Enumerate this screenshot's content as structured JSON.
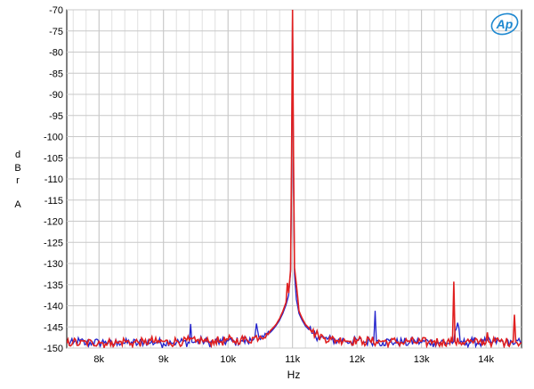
{
  "chart_data": {
    "type": "line",
    "title": "",
    "xlabel": "Hz",
    "ylabel": [
      "d",
      "B",
      "r",
      "A"
    ],
    "xscale": "linear",
    "xlim": [
      7500,
      14550
    ],
    "ylim": [
      -150,
      -70
    ],
    "grid": true,
    "x_ticks": [
      8000,
      9000,
      10000,
      11000,
      12000,
      13000,
      14000
    ],
    "x_tick_labels": [
      "8k",
      "9k",
      "10k",
      "11k",
      "12k",
      "13k",
      "14k"
    ],
    "y_ticks": [
      -70,
      -75,
      -80,
      -85,
      -90,
      -95,
      -100,
      -105,
      -110,
      -115,
      -120,
      -125,
      -130,
      -135,
      -140,
      -145,
      -150
    ],
    "y_tick_labels": [
      "-70",
      "-75",
      "-80",
      "-85",
      "-90",
      "-95",
      "-100",
      "-105",
      "-110",
      "-115",
      "-120",
      "-125",
      "-130",
      "-135",
      "-140",
      "-145",
      "-150"
    ],
    "logo": {
      "text": "AP",
      "color": "#1e88d0"
    },
    "series": [
      {
        "color": "#2222cc",
        "noise_floor": -148.8,
        "points": [
          [
            7500,
            -148.7
          ],
          [
            7600,
            -148.9
          ],
          [
            7700,
            -148.3
          ],
          [
            7800,
            -149.0
          ],
          [
            7900,
            -148.6
          ],
          [
            8000,
            -148.8
          ],
          [
            8100,
            -148.4
          ],
          [
            8200,
            -149.1
          ],
          [
            8300,
            -148.5
          ],
          [
            8400,
            -148.9
          ],
          [
            8500,
            -148.6
          ],
          [
            8600,
            -149.0
          ],
          [
            8700,
            -148.4
          ],
          [
            8800,
            -148.8
          ],
          [
            8900,
            -148.5
          ],
          [
            9000,
            -148.9
          ],
          [
            9100,
            -148.3
          ],
          [
            9200,
            -148.7
          ],
          [
            9300,
            -148.5
          ],
          [
            9400,
            -148.8
          ],
          [
            9420,
            -144.3
          ],
          [
            9440,
            -148.6
          ],
          [
            9500,
            -148.6
          ],
          [
            9600,
            -148.2
          ],
          [
            9700,
            -148.8
          ],
          [
            9800,
            -148.4
          ],
          [
            9900,
            -148.7
          ],
          [
            10000,
            -148.3
          ],
          [
            10100,
            -148.6
          ],
          [
            10200,
            -148.2
          ],
          [
            10300,
            -148.5
          ],
          [
            10400,
            -147.9
          ],
          [
            10440,
            -144.2
          ],
          [
            10480,
            -147.6
          ],
          [
            10550,
            -147.5
          ],
          [
            10600,
            -147.0
          ],
          [
            10650,
            -146.4
          ],
          [
            10700,
            -145.6
          ],
          [
            10750,
            -144.6
          ],
          [
            10800,
            -143.4
          ],
          [
            10850,
            -141.8
          ],
          [
            10900,
            -139.8
          ],
          [
            10940,
            -137.5
          ],
          [
            10970,
            -132.0
          ],
          [
            10985,
            -110.0
          ],
          [
            11000,
            -70.0
          ],
          [
            11015,
            -110.0
          ],
          [
            11030,
            -132.5
          ],
          [
            11060,
            -138.5
          ],
          [
            11100,
            -141.8
          ],
          [
            11150,
            -143.5
          ],
          [
            11200,
            -144.8
          ],
          [
            11250,
            -145.6
          ],
          [
            11300,
            -146.5
          ],
          [
            11400,
            -147.3
          ],
          [
            11500,
            -147.8
          ],
          [
            11600,
            -148.0
          ],
          [
            11700,
            -148.3
          ],
          [
            11800,
            -148.1
          ],
          [
            11900,
            -148.5
          ],
          [
            12000,
            -148.2
          ],
          [
            12100,
            -148.6
          ],
          [
            12200,
            -148.4
          ],
          [
            12260,
            -148.3
          ],
          [
            12280,
            -141.2
          ],
          [
            12300,
            -148.4
          ],
          [
            12400,
            -148.7
          ],
          [
            12500,
            -148.3
          ],
          [
            12600,
            -148.8
          ],
          [
            12700,
            -148.5
          ],
          [
            12800,
            -148.9
          ],
          [
            12900,
            -148.4
          ],
          [
            13000,
            -148.7
          ],
          [
            13100,
            -148.3
          ],
          [
            13200,
            -148.8
          ],
          [
            13300,
            -148.5
          ],
          [
            13400,
            -148.9
          ],
          [
            13500,
            -148.4
          ],
          [
            13560,
            -144.0
          ],
          [
            13600,
            -148.6
          ],
          [
            13700,
            -148.8
          ],
          [
            13800,
            -148.4
          ],
          [
            13900,
            -148.9
          ],
          [
            14000,
            -148.5
          ],
          [
            14100,
            -148.7
          ],
          [
            14200,
            -148.3
          ],
          [
            14300,
            -148.8
          ],
          [
            14400,
            -148.5
          ],
          [
            14450,
            -148.9
          ],
          [
            14550,
            -148.6
          ]
        ]
      },
      {
        "color": "#e02020",
        "noise_floor": -148.6,
        "points": [
          [
            7500,
            -148.9
          ],
          [
            7600,
            -148.5
          ],
          [
            7700,
            -149.1
          ],
          [
            7800,
            -148.6
          ],
          [
            7900,
            -148.9
          ],
          [
            8000,
            -148.4
          ],
          [
            8100,
            -149.0
          ],
          [
            8200,
            -148.6
          ],
          [
            8300,
            -148.8
          ],
          [
            8400,
            -148.3
          ],
          [
            8500,
            -148.9
          ],
          [
            8600,
            -148.5
          ],
          [
            8700,
            -148.8
          ],
          [
            8800,
            -148.2
          ],
          [
            8900,
            -148.7
          ],
          [
            9000,
            -148.4
          ],
          [
            9100,
            -148.8
          ],
          [
            9200,
            -148.3
          ],
          [
            9300,
            -148.6
          ],
          [
            9400,
            -148.2
          ],
          [
            9500,
            -148.5
          ],
          [
            9600,
            -148.1
          ],
          [
            9700,
            -148.6
          ],
          [
            9800,
            -148.2
          ],
          [
            9900,
            -148.5
          ],
          [
            10000,
            -148.0
          ],
          [
            10100,
            -148.4
          ],
          [
            10200,
            -147.9
          ],
          [
            10300,
            -148.2
          ],
          [
            10400,
            -147.6
          ],
          [
            10500,
            -147.2
          ],
          [
            10600,
            -146.6
          ],
          [
            10650,
            -146.0
          ],
          [
            10700,
            -145.2
          ],
          [
            10750,
            -144.3
          ],
          [
            10800,
            -143.0
          ],
          [
            10850,
            -141.3
          ],
          [
            10900,
            -139.2
          ],
          [
            10920,
            -134.6
          ],
          [
            10940,
            -137.0
          ],
          [
            10970,
            -131.5
          ],
          [
            10985,
            -105.0
          ],
          [
            11000,
            -70.0
          ],
          [
            11015,
            -105.0
          ],
          [
            11030,
            -131.0
          ],
          [
            11055,
            -134.4
          ],
          [
            11080,
            -138.0
          ],
          [
            11100,
            -141.2
          ],
          [
            11150,
            -143.0
          ],
          [
            11200,
            -144.4
          ],
          [
            11250,
            -145.2
          ],
          [
            11300,
            -146.2
          ],
          [
            11400,
            -147.0
          ],
          [
            11500,
            -147.6
          ],
          [
            11600,
            -147.9
          ],
          [
            11700,
            -148.2
          ],
          [
            11800,
            -147.9
          ],
          [
            11900,
            -148.4
          ],
          [
            12000,
            -148.1
          ],
          [
            12100,
            -148.5
          ],
          [
            12200,
            -148.2
          ],
          [
            12300,
            -148.6
          ],
          [
            12400,
            -148.3
          ],
          [
            12500,
            -148.7
          ],
          [
            12600,
            -148.4
          ],
          [
            12700,
            -148.8
          ],
          [
            12800,
            -148.3
          ],
          [
            12900,
            -148.7
          ],
          [
            13000,
            -148.4
          ],
          [
            13100,
            -148.8
          ],
          [
            13200,
            -148.3
          ],
          [
            13300,
            -148.7
          ],
          [
            13400,
            -148.4
          ],
          [
            13480,
            -148.6
          ],
          [
            13500,
            -134.3
          ],
          [
            13520,
            -148.5
          ],
          [
            13600,
            -148.7
          ],
          [
            13700,
            -148.3
          ],
          [
            13800,
            -148.8
          ],
          [
            13900,
            -148.4
          ],
          [
            14000,
            -148.7
          ],
          [
            14020,
            -146.3
          ],
          [
            14040,
            -148.5
          ],
          [
            14100,
            -148.6
          ],
          [
            14200,
            -148.3
          ],
          [
            14300,
            -148.7
          ],
          [
            14400,
            -148.4
          ],
          [
            14420,
            -148.6
          ],
          [
            14440,
            -142.1
          ],
          [
            14460,
            -148.5
          ],
          [
            14550,
            -148.7
          ]
        ]
      }
    ]
  }
}
